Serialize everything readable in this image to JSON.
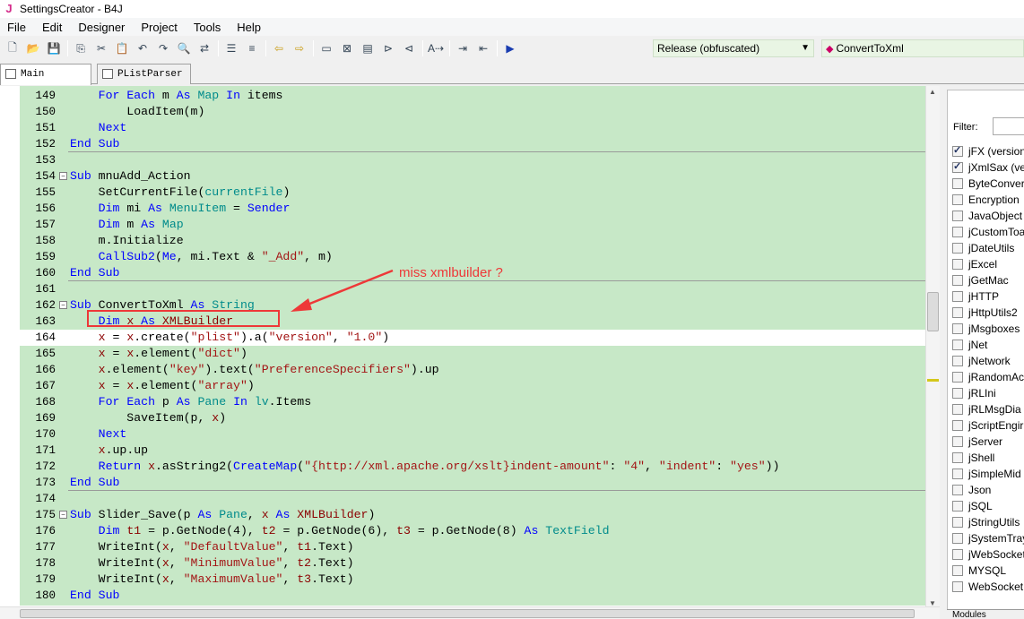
{
  "window": {
    "title": "SettingsCreator - B4J",
    "app_icon": "J"
  },
  "menu": [
    "File",
    "Edit",
    "Designer",
    "Project",
    "Tools",
    "Help"
  ],
  "toolbar": {
    "icons": [
      "new-file-icon",
      "open-folder-icon",
      "save-icon",
      "copy-icon",
      "cut-icon",
      "paste-icon",
      "undo-icon",
      "redo-icon",
      "find-icon",
      "find-replace-icon",
      "indent-icon",
      "outdent-icon",
      "nav-back-icon",
      "nav-forward-icon",
      "comment-icon",
      "uncomment-icon",
      "bookmark-icon",
      "bookmark-next-icon",
      "bookmark-prev-icon",
      "autoformat-icon",
      "block-indent-icon",
      "block-outdent-icon",
      "run-icon"
    ],
    "build_config": "Release (obfuscated)",
    "sub_selector": "ConvertToXml"
  },
  "tabs": [
    {
      "label": "Main"
    },
    {
      "label": "PListParser"
    }
  ],
  "code_lines": [
    {
      "n": "149",
      "html": "    <span class='kw'>For</span> <span class='kw'>Each</span> m <span class='kw'>As</span> <span class='ty'>Map</span> <span class='kw'>In</span> items"
    },
    {
      "n": "150",
      "html": "        LoadItem(m)"
    },
    {
      "n": "151",
      "html": "    <span class='kw'>Next</span>"
    },
    {
      "n": "152",
      "html": "<span class='kw'>End</span> <span class='kw'>Sub</span>"
    },
    {
      "n": "153",
      "html": ""
    },
    {
      "n": "154",
      "html": "<span class='kw'>Sub</span> mnuAdd_Action"
    },
    {
      "n": "155",
      "html": "    SetCurrentFile(<span class='ty'>currentFile</span>)"
    },
    {
      "n": "156",
      "html": "    <span class='kw'>Dim</span> mi <span class='kw'>As</span> <span class='ty'>MenuItem</span> = <span class='kw'>Sender</span>"
    },
    {
      "n": "157",
      "html": "    <span class='kw'>Dim</span> m <span class='kw'>As</span> <span class='ty'>Map</span>"
    },
    {
      "n": "158",
      "html": "    m.Initialize"
    },
    {
      "n": "159",
      "html": "    <span class='kw'>CallSub2</span>(<span class='kw'>Me</span>, mi.Text &amp; <span class='st'>\"_Add\"</span>, m)"
    },
    {
      "n": "160",
      "html": "<span class='kw'>End</span> <span class='kw'>Sub</span>"
    },
    {
      "n": "161",
      "html": ""
    },
    {
      "n": "162",
      "html": "<span class='kw'>Sub</span> ConvertToXml <span class='kw'>As</span> <span class='ty'>String</span>"
    },
    {
      "n": "163",
      "html": "    <span class='kw'>Dim</span> <span class='vr'>x</span> <span class='kw'>As</span> <span class='vr'>XMLBuilder</span>"
    },
    {
      "n": "164",
      "html": "    <span class='vr'>x</span> = <span class='vr'>x</span>.create(<span class='st'>\"plist\"</span>).a(<span class='st'>\"version\"</span>, <span class='st'>\"1.0\"</span>)"
    },
    {
      "n": "165",
      "html": "    <span class='vr'>x</span> = <span class='vr'>x</span>.element(<span class='st'>\"dict\"</span>)"
    },
    {
      "n": "166",
      "html": "    <span class='vr'>x</span>.element(<span class='st'>\"key\"</span>).text(<span class='st'>\"PreferenceSpecifiers\"</span>).up"
    },
    {
      "n": "167",
      "html": "    <span class='vr'>x</span> = <span class='vr'>x</span>.element(<span class='st'>\"array\"</span>)"
    },
    {
      "n": "168",
      "html": "    <span class='kw'>For</span> <span class='kw'>Each</span> p <span class='kw'>As</span> <span class='ty'>Pane</span> <span class='kw'>In</span> <span class='ty'>lv</span>.Items"
    },
    {
      "n": "169",
      "html": "        SaveItem(p, <span class='vr'>x</span>)"
    },
    {
      "n": "170",
      "html": "    <span class='kw'>Next</span>"
    },
    {
      "n": "171",
      "html": "    <span class='vr'>x</span>.up.up"
    },
    {
      "n": "172",
      "html": "    <span class='kw'>Return</span> <span class='vr'>x</span>.asString2(<span class='kw'>CreateMap</span>(<span class='st'>\"{http://xml.apache.org/xslt}indent-amount\"</span>: <span class='st'>\"4\"</span>, <span class='st'>\"indent\"</span>: <span class='st'>\"yes\"</span>))"
    },
    {
      "n": "173",
      "html": "<span class='kw'>End</span> <span class='kw'>Sub</span>"
    },
    {
      "n": "174",
      "html": ""
    },
    {
      "n": "175",
      "html": "<span class='kw'>Sub</span> Slider_Save(p <span class='kw'>As</span> <span class='ty'>Pane</span>, <span class='vr'>x</span> <span class='kw'>As</span> <span class='vr'>XMLBuilder</span>)"
    },
    {
      "n": "176",
      "html": "    <span class='kw'>Dim</span> <span class='vr'>t1</span> = p.GetNode(4), <span class='vr'>t2</span> = p.GetNode(6), <span class='vr'>t3</span> = p.GetNode(8) <span class='kw'>As</span> <span class='ty'>TextField</span>"
    },
    {
      "n": "177",
      "html": "    WriteInt(<span class='vr'>x</span>, <span class='st'>\"DefaultValue\"</span>, <span class='vr'>t1</span>.Text)"
    },
    {
      "n": "178",
      "html": "    WriteInt(<span class='vr'>x</span>, <span class='st'>\"MinimumValue\"</span>, <span class='vr'>t2</span>.Text)"
    },
    {
      "n": "179",
      "html": "    WriteInt(<span class='vr'>x</span>, <span class='st'>\"MaximumValue\"</span>, <span class='vr'>t3</span>.Text)"
    },
    {
      "n": "180",
      "html": "<span class='kw'>End</span> <span class='kw'>Sub</span>"
    }
  ],
  "libraries": {
    "filter_label": "Filter:",
    "items": [
      {
        "name": "jFX (version",
        "checked": true
      },
      {
        "name": "jXmlSax (ve",
        "checked": true
      },
      {
        "name": "ByteConvert",
        "checked": false
      },
      {
        "name": "Encryption",
        "checked": false
      },
      {
        "name": "JavaObject",
        "checked": false
      },
      {
        "name": "jCustomToa",
        "checked": false
      },
      {
        "name": "jDateUtils",
        "checked": false
      },
      {
        "name": "jExcel",
        "checked": false
      },
      {
        "name": "jGetMac",
        "checked": false
      },
      {
        "name": "jHTTP",
        "checked": false
      },
      {
        "name": "jHttpUtils2",
        "checked": false
      },
      {
        "name": "jMsgboxes",
        "checked": false
      },
      {
        "name": "jNet",
        "checked": false
      },
      {
        "name": "jNetwork",
        "checked": false
      },
      {
        "name": "jRandomAc",
        "checked": false
      },
      {
        "name": "jRLIni",
        "checked": false
      },
      {
        "name": "jRLMsgDia",
        "checked": false
      },
      {
        "name": "jScriptEngir",
        "checked": false
      },
      {
        "name": "jServer",
        "checked": false
      },
      {
        "name": "jShell",
        "checked": false
      },
      {
        "name": "jSimpleMid",
        "checked": false
      },
      {
        "name": "Json",
        "checked": false
      },
      {
        "name": "jSQL",
        "checked": false
      },
      {
        "name": "jStringUtils",
        "checked": false
      },
      {
        "name": "jSystemTray",
        "checked": false
      },
      {
        "name": "jWebSocket",
        "checked": false
      },
      {
        "name": "MYSQL",
        "checked": false
      },
      {
        "name": "WebSocket",
        "checked": false
      }
    ],
    "bottom_tab": "Modules"
  },
  "annotation": {
    "text": "miss xmlbuilder ?",
    "color": "#ee3838"
  },
  "colors": {
    "code_bg": "#c7e8c7",
    "keyword": "#0000ff",
    "type": "#008b8b",
    "string": "#a31515",
    "highlight": "#8b0000"
  }
}
